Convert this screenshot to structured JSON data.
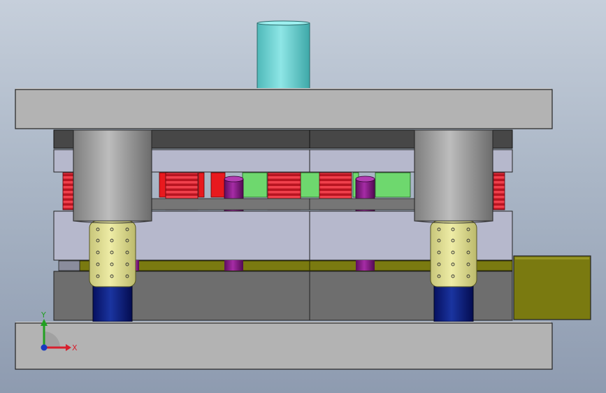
{
  "viewport": {
    "colors": {
      "plate": "#b4b4b4",
      "plate_dark": "#4a4a4a",
      "plate_light": "#b4b6cc",
      "die_block": "#6e6e6e",
      "punch": "#6fd6d6",
      "guide_bushing": "#e6e49a",
      "guide_post": "#b9b9b9",
      "pillar": "#0a1c7a",
      "spring": "#d8202e",
      "stripper_bolt": "#8c1c8c",
      "green_block": "#6ed86e",
      "red_block": "#e8191e",
      "olive_block": "#7a7a10"
    }
  },
  "triad": {
    "x_label": "X",
    "y_label": "Y",
    "x_color": "#d8202e",
    "y_color": "#22a022",
    "z_color": "#1a3ac0"
  }
}
